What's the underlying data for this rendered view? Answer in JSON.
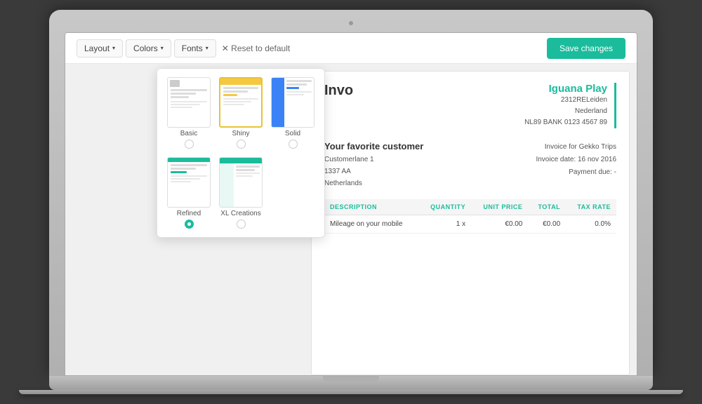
{
  "toolbar": {
    "layout_label": "Layout",
    "colors_label": "Colors",
    "fonts_label": "Fonts",
    "reset_label": "✕ Reset to default",
    "save_label": "Save changes"
  },
  "dropdown": {
    "items": [
      {
        "id": "basic",
        "label": "Basic",
        "selected": false
      },
      {
        "id": "shiny",
        "label": "Shiny",
        "selected": false
      },
      {
        "id": "solid",
        "label": "Solid",
        "selected": false
      },
      {
        "id": "refined",
        "label": "Refined",
        "selected": true
      },
      {
        "id": "xl",
        "label": "XL Creations",
        "selected": false
      }
    ]
  },
  "invoice": {
    "title": "Invo",
    "company": {
      "name": "Iguana Play",
      "address_line1": "2312RELeiden",
      "address_line2": "Nederland",
      "bank": "NL89 BANK 0123 4567 89"
    },
    "customer": {
      "name": "Your favorite customer",
      "address_line1": "Customerlane 1",
      "address_line2": "1337 AA",
      "address_line3": "Netherlands"
    },
    "meta": {
      "invoice_for": "Invoice for Gekko Trips",
      "invoice_date": "Invoice date: 16 nov 2016",
      "payment_due": "Payment due: -"
    },
    "table": {
      "headers": [
        "DESCRIPTION",
        "QUANTITY",
        "UNIT PRICE",
        "TOTAL",
        "TAX RATE"
      ],
      "rows": [
        {
          "description": "Mileage on your mobile",
          "quantity": "1 x",
          "unit_price": "€0.00",
          "total": "€0.00",
          "tax_rate": "0.0%"
        }
      ]
    }
  }
}
